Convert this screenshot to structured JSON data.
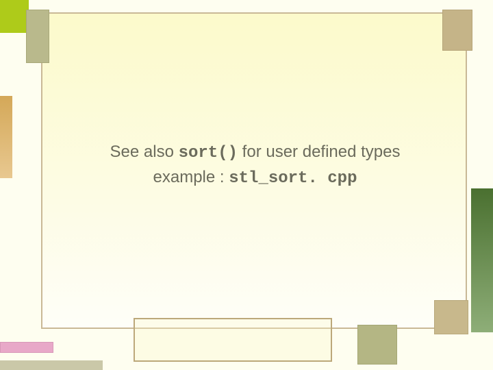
{
  "slide": {
    "line1_part1": "See also ",
    "line1_code": "sort()",
    "line1_part2": "  for user defined types",
    "line2_part1": "example : ",
    "line2_code": "stl_sort. cpp"
  }
}
